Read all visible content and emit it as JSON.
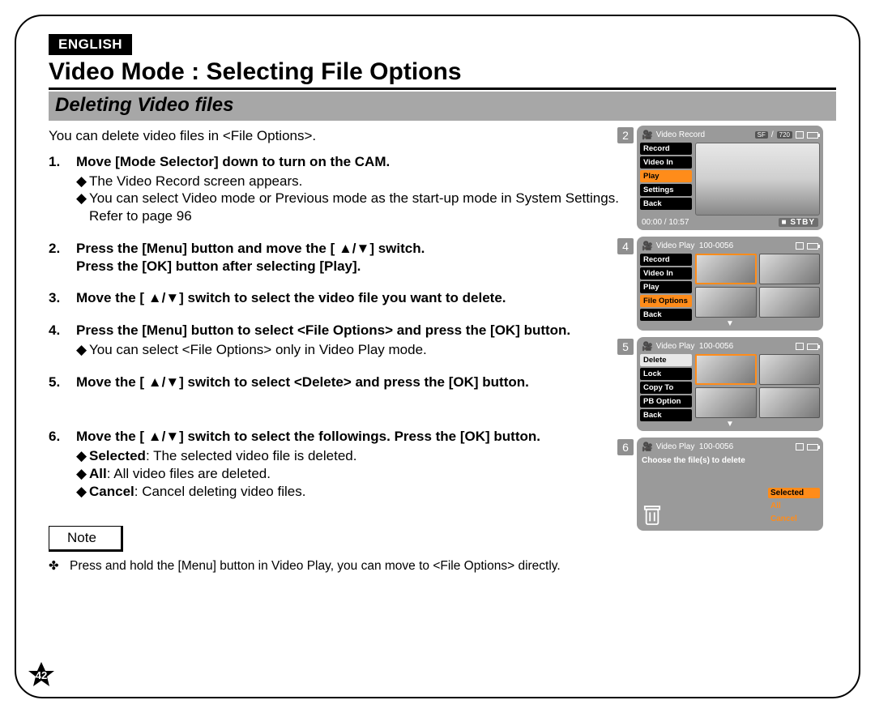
{
  "lang_tab": "ENGLISH",
  "title": "Video Mode : Selecting File Options",
  "subtitle": "Deleting Video files",
  "intro": "You can delete video files in <File Options>.",
  "steps": [
    {
      "num": "1.",
      "lead": "Move [Mode Selector] down to turn on the CAM.",
      "subs": [
        "The Video Record screen appears.",
        "You can select Video mode or Previous mode as the start-up mode in System Settings. Refer to page 96"
      ]
    },
    {
      "num": "2.",
      "lead": "Press the [Menu] button and move the [ ▲/▼] switch.\nPress the [OK] button after selecting [Play]."
    },
    {
      "num": "3.",
      "lead": "Move the [ ▲/▼] switch to select the video file you want to delete."
    },
    {
      "num": "4.",
      "lead": "Press the [Menu] button to select <File Options> and press the [OK] button.",
      "subs": [
        "You can select <File Options> only in Video Play mode."
      ]
    },
    {
      "num": "5.",
      "lead": "Move the [ ▲/▼] switch to select <Delete> and press the [OK] button."
    },
    {
      "num": "6.",
      "lead": "Move the [ ▲/▼] switch to select the followings. Press the [OK] button.",
      "rich_subs": [
        {
          "b": "Selected",
          "t": ": The selected video file is deleted."
        },
        {
          "b": "All",
          "t": ": All video files are deleted."
        },
        {
          "b": "Cancel",
          "t": ": Cancel deleting video files."
        }
      ]
    }
  ],
  "note_label": "Note",
  "note_text": "Press and hold the [Menu] button in Video Play, you can move to <File Options> directly.",
  "page_number": "42",
  "shots": {
    "s2": {
      "tag": "2",
      "title": "Video Record",
      "pills": [
        "SF",
        "720"
      ],
      "menu": [
        "Record",
        "Video In",
        "Play",
        "Settings",
        "Back"
      ],
      "selected": "Play",
      "time": "00:00 / 10:57",
      "status": "STBY"
    },
    "s4": {
      "tag": "4",
      "title": "Video Play",
      "file": "100-0056",
      "menu": [
        "Record",
        "Video In",
        "Play",
        "File Options",
        "Back"
      ],
      "selected": "File Options"
    },
    "s5": {
      "tag": "5",
      "title": "Video Play",
      "file": "100-0056",
      "menu": [
        "Delete",
        "Lock",
        "Copy To",
        "PB Option",
        "Back"
      ],
      "selected": "Delete"
    },
    "s6": {
      "tag": "6",
      "title": "Video Play",
      "file": "100-0056",
      "prompt": "Choose the file(s) to delete",
      "options": [
        "Selected",
        "All",
        "Cancel"
      ],
      "selected": "Selected"
    }
  }
}
